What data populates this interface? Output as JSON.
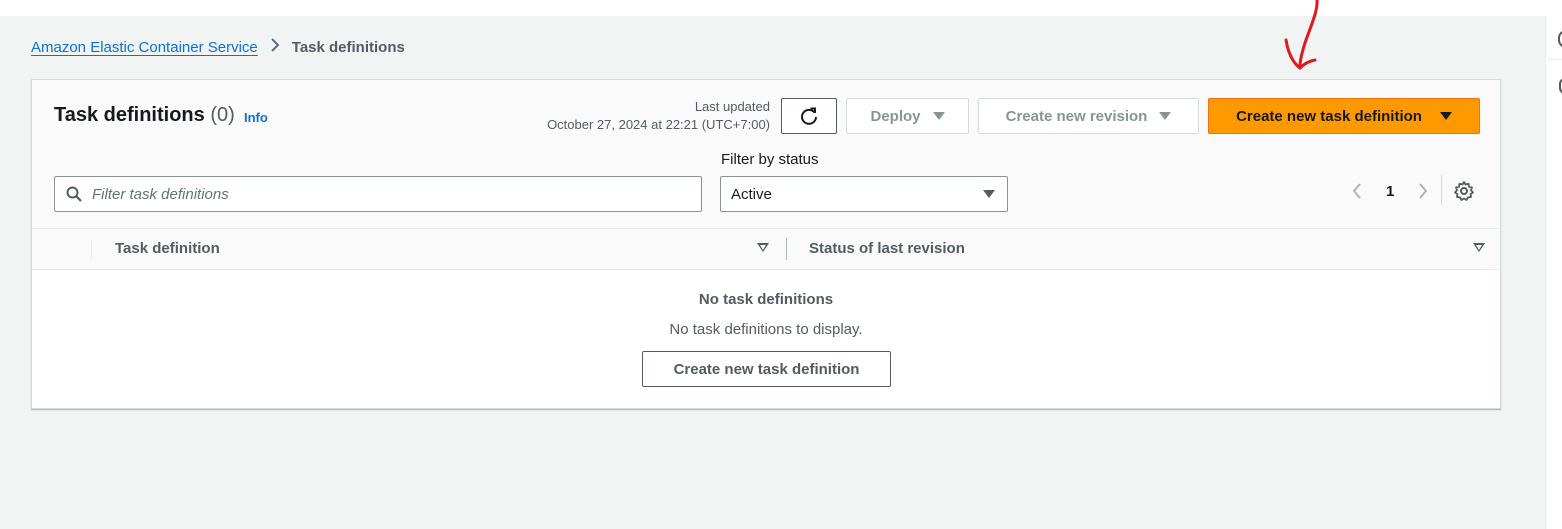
{
  "breadcrumb": {
    "parent": "Amazon Elastic Container Service",
    "current": "Task definitions"
  },
  "panel": {
    "title": "Task definitions",
    "count": "(0)",
    "info_label": "Info",
    "last_updated_label": "Last updated",
    "last_updated_value": "October 27, 2024 at 22:21 (UTC+7:00)"
  },
  "toolbar": {
    "deploy_label": "Deploy",
    "create_revision_label": "Create new revision",
    "create_definition_label": "Create new task definition"
  },
  "filters": {
    "status_label": "Filter by status",
    "search_placeholder": "Filter task definitions",
    "status_value": "Active"
  },
  "pagination": {
    "current_page": "1"
  },
  "table": {
    "columns": [
      "Task definition",
      "Status of last revision"
    ],
    "rows": []
  },
  "empty_state": {
    "title": "No task definitions",
    "description": "No task definitions to display.",
    "button_label": "Create new task definition"
  },
  "colors": {
    "primary_button": "#ff9900",
    "link": "#0972d3",
    "annotation": "#e0191e"
  },
  "icons": [
    "refresh-icon",
    "caret-down-icon",
    "search-icon",
    "chevron-left-icon",
    "chevron-right-icon",
    "gear-icon",
    "sort-icon",
    "annotation-arrow-icon"
  ]
}
